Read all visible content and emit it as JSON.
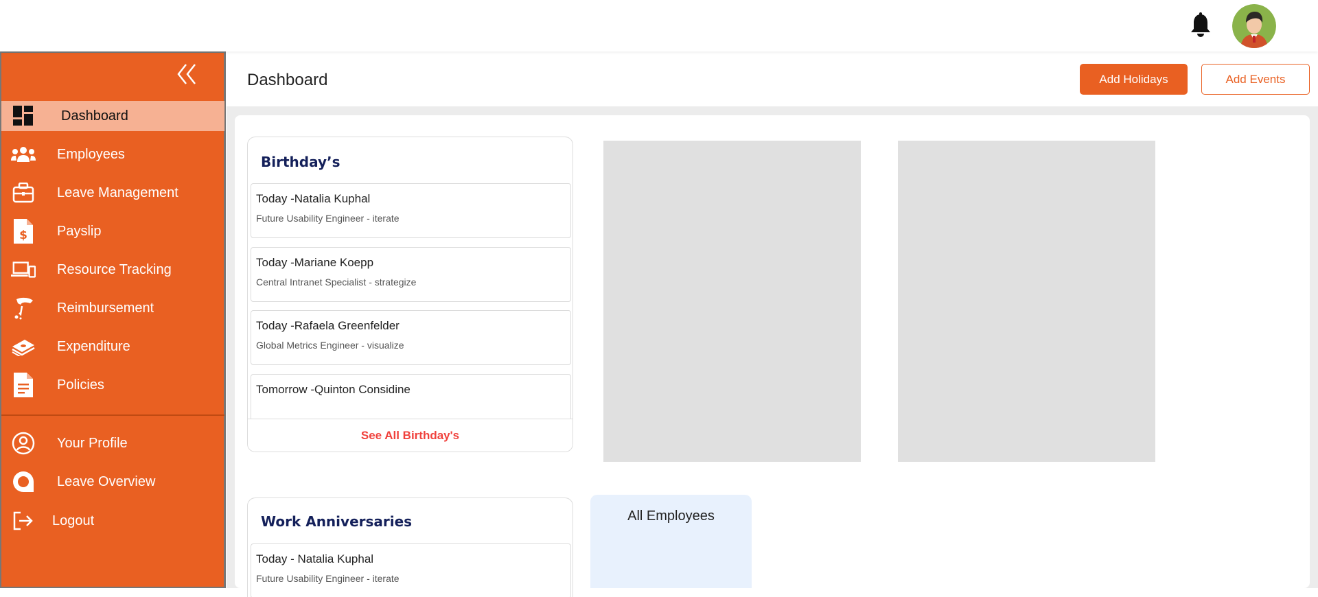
{
  "header": {
    "notification_icon": "bell-icon",
    "avatar_icon": "user-avatar"
  },
  "sidebar": {
    "collapse_icon": "double-chevron-left-icon",
    "items": [
      {
        "label": "Dashboard",
        "icon": "dashboard-icon",
        "active": true
      },
      {
        "label": "Employees",
        "icon": "group-icon"
      },
      {
        "label": "Leave Management",
        "icon": "briefcase-icon"
      },
      {
        "label": "Payslip",
        "icon": "dollar-document-icon"
      },
      {
        "label": "Resource Tracking",
        "icon": "devices-icon"
      },
      {
        "label": "Reimbursement",
        "icon": "hand-coin-icon"
      },
      {
        "label": "Expenditure",
        "icon": "money-stack-icon"
      },
      {
        "label": "Policies",
        "icon": "document-icon"
      }
    ],
    "bottom_items": [
      {
        "label": "Your Profile",
        "icon": "user-circle-icon"
      },
      {
        "label": "Leave Overview",
        "icon": "overview-icon"
      },
      {
        "label": "Logout",
        "icon": "logout-icon"
      }
    ]
  },
  "main": {
    "title": "Dashboard",
    "add_holidays_label": "Add Holidays",
    "add_events_label": "Add Events"
  },
  "birthdays": {
    "title": "Birthday’s",
    "entries": [
      {
        "name": "Today -Natalia Kuphal",
        "role": "Future Usability Engineer - iterate"
      },
      {
        "name": "Today -Mariane Koepp",
        "role": "Central Intranet Specialist - strategize"
      },
      {
        "name": "Today -Rafaela Greenfelder",
        "role": "Global Metrics Engineer - visualize"
      },
      {
        "name": "Tomorrow -Quinton Considine",
        "role": ""
      }
    ],
    "see_all_label": "See All Birthday's"
  },
  "anniversaries": {
    "title": "Work Anniversaries",
    "entries": [
      {
        "name": "Today - Natalia Kuphal",
        "role": "Future Usability Engineer - iterate"
      }
    ]
  },
  "all_employees": {
    "title": "All Employees"
  },
  "colors": {
    "accent": "#e96022",
    "active_nav": "#f6b193",
    "heading": "#14205a",
    "link": "#f0413c"
  }
}
